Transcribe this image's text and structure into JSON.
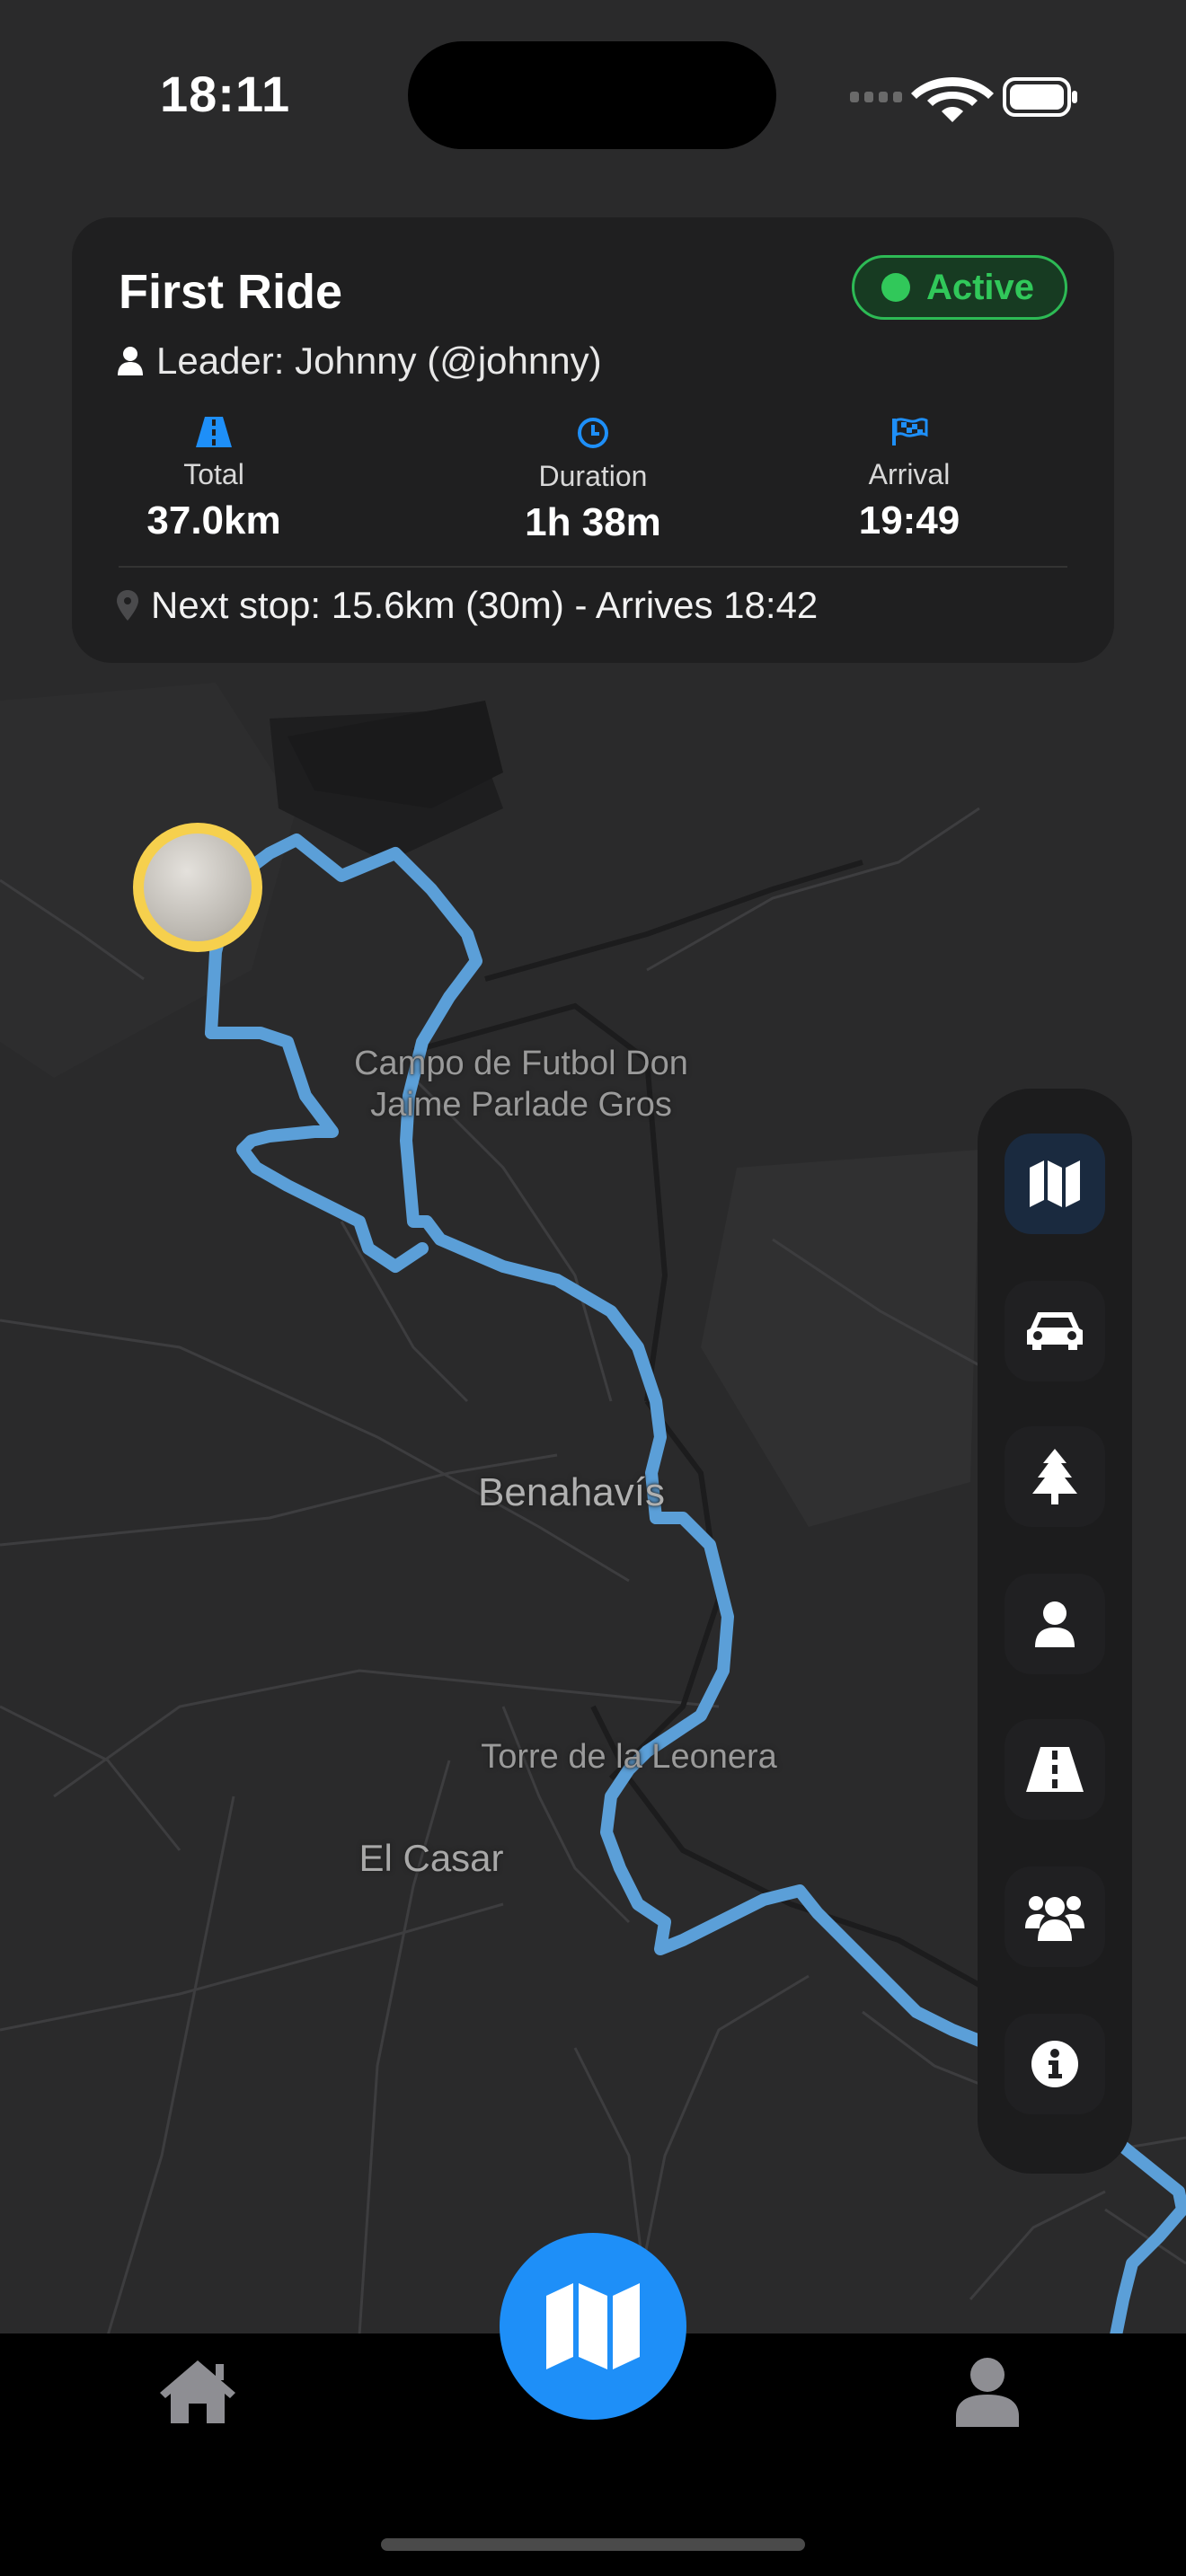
{
  "status_bar": {
    "time": "18:11"
  },
  "ride_card": {
    "title": "First Ride",
    "status": "Active",
    "leader": "Leader: Johnny (@johnny)",
    "stats": [
      {
        "icon": "road-icon",
        "label": "Total",
        "value": "37.0km"
      },
      {
        "icon": "clock-icon",
        "label": "Duration",
        "value": "1h 38m"
      },
      {
        "icon": "flag-icon",
        "label": "Arrival",
        "value": "19:49"
      }
    ],
    "next_stop": "Next stop: 15.6km (30m) - Arrives 18:42",
    "colors": {
      "accent": "#1e8ff8",
      "active": "#31c85a",
      "card": "#1f1f20"
    }
  },
  "map": {
    "labels": [
      "Campo de Futbol Don\nJaime Parlade Gros",
      "Benahavís",
      "Torre de la Leonera",
      "El Casar"
    ],
    "route_color": "#5b9fd8",
    "marker_color": "#f6d04d"
  },
  "layer_panel": {
    "items": [
      "map-icon",
      "car-icon",
      "tree-icon",
      "user-icon",
      "road-icon",
      "users-icon",
      "info-icon"
    ],
    "selected": "map-icon"
  },
  "tab_bar": {
    "items": [
      "home-icon",
      "map-icon",
      "profile-icon"
    ],
    "active": "map-icon"
  }
}
